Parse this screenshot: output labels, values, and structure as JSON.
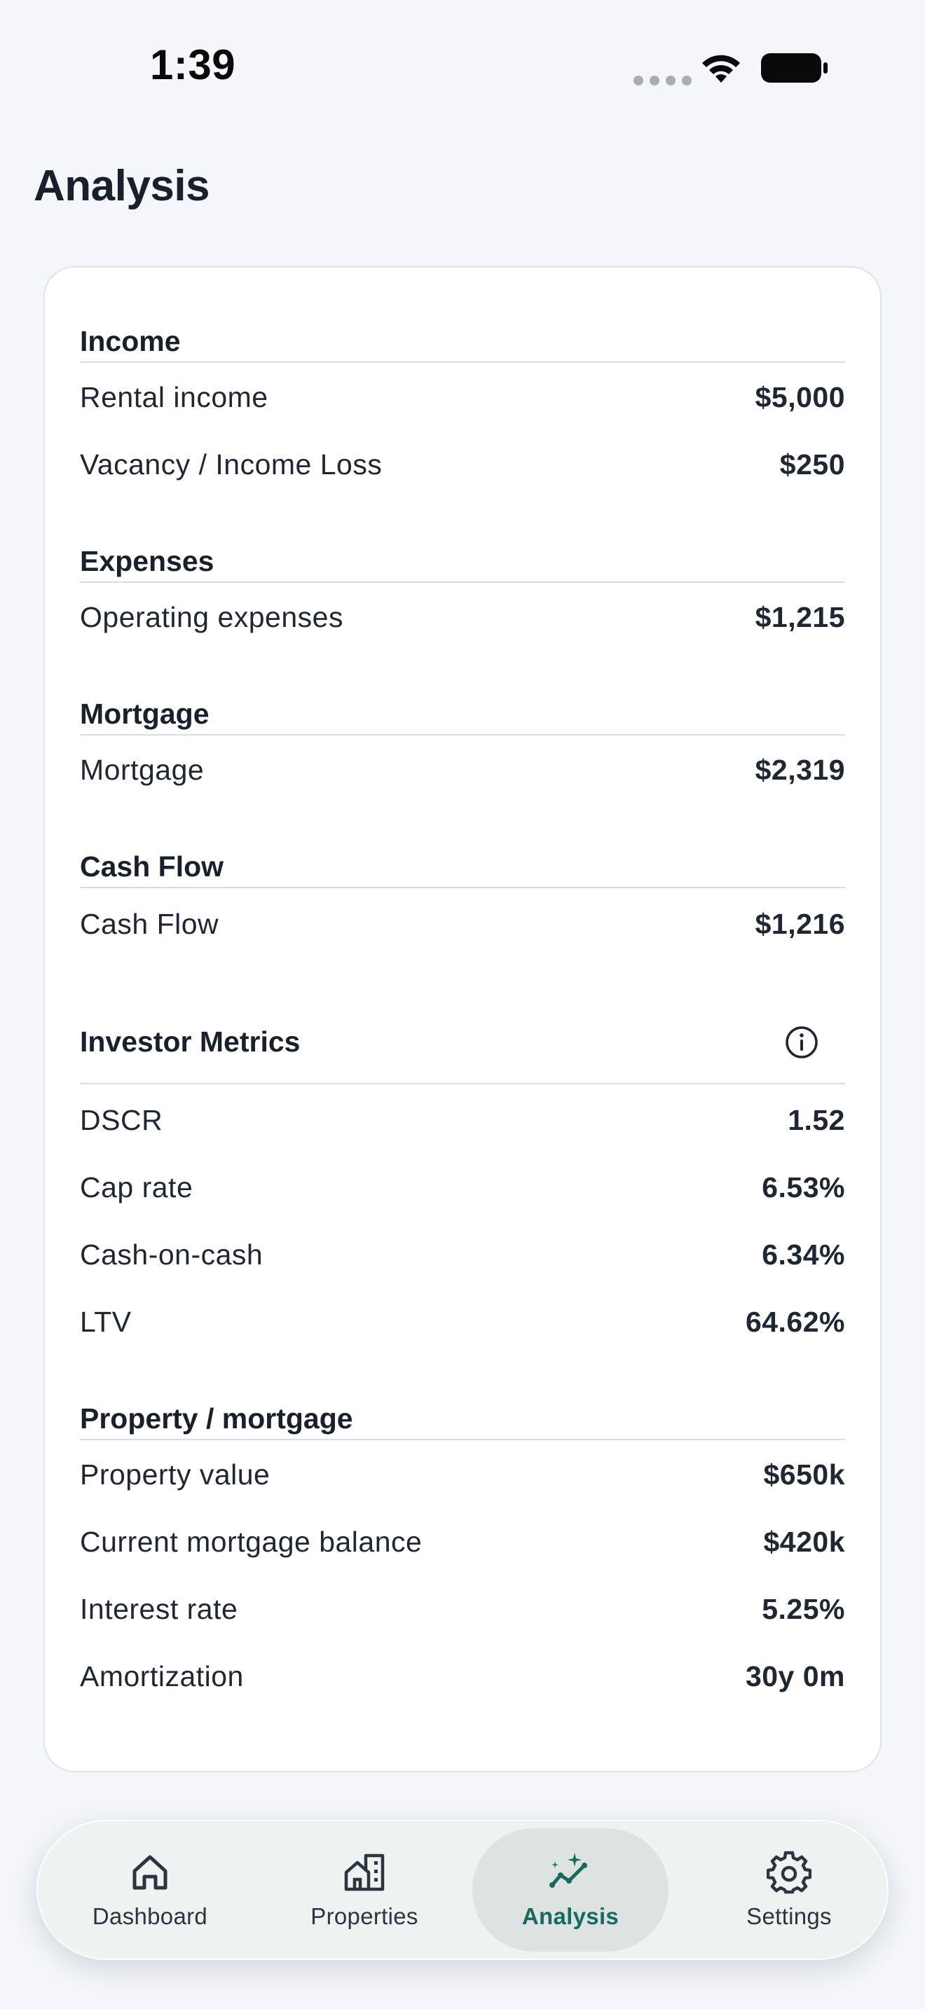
{
  "status_bar": {
    "time": "1:39"
  },
  "page": {
    "title": "Analysis"
  },
  "colors": {
    "accent": "#186a5e",
    "background": "#f4f6f9",
    "card": "#ffffff",
    "active_tab_bg": "#dde3e1"
  },
  "sections": {
    "income": {
      "heading": "Income",
      "rows": [
        {
          "label": "Rental income",
          "value": "$5,000"
        },
        {
          "label": "Vacancy / Income Loss",
          "value": "$250"
        }
      ]
    },
    "expenses": {
      "heading": "Expenses",
      "rows": [
        {
          "label": "Operating expenses",
          "value": "$1,215"
        }
      ]
    },
    "mortgage": {
      "heading": "Mortgage",
      "rows": [
        {
          "label": "Mortgage",
          "value": "$2,319"
        }
      ]
    },
    "cash_flow": {
      "heading": "Cash Flow",
      "rows": [
        {
          "label": "Cash Flow",
          "value": "$1,216"
        }
      ]
    },
    "investor_metrics": {
      "heading": "Investor Metrics",
      "info_icon": "info-circle-icon",
      "rows": [
        {
          "label": "DSCR",
          "value": "1.52"
        },
        {
          "label": "Cap rate",
          "value": "6.53%"
        },
        {
          "label": "Cash-on-cash",
          "value": "6.34%"
        },
        {
          "label": "LTV",
          "value": "64.62%"
        }
      ]
    },
    "property_mortgage": {
      "heading": "Property / mortgage",
      "rows": [
        {
          "label": "Property value",
          "value": "$650k"
        },
        {
          "label": "Current mortgage balance",
          "value": "$420k"
        },
        {
          "label": "Interest rate",
          "value": "5.25%"
        },
        {
          "label": "Amortization",
          "value": "30y 0m"
        }
      ]
    }
  },
  "tab_bar": {
    "tabs": [
      {
        "label": "Dashboard",
        "icon": "home-icon",
        "active": false
      },
      {
        "label": "Properties",
        "icon": "buildings-icon",
        "active": false
      },
      {
        "label": "Analysis",
        "icon": "sparkle-chart-icon",
        "active": true
      },
      {
        "label": "Settings",
        "icon": "gear-icon",
        "active": false
      }
    ]
  }
}
